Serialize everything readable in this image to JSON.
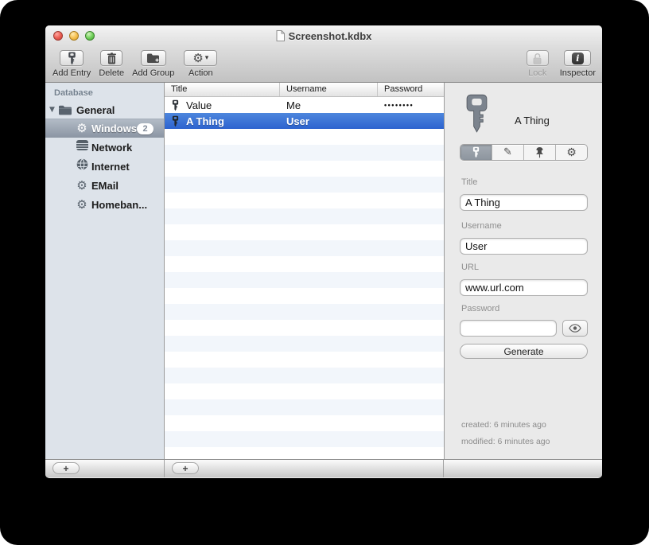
{
  "window": {
    "title": "Screenshot.kdbx"
  },
  "toolbar": {
    "add_entry_label": "Add Entry",
    "delete_label": "Delete",
    "add_group_label": "Add Group",
    "action_label": "Action",
    "lock_label": "Lock",
    "inspector_label": "Inspector"
  },
  "sidebar": {
    "header": "Database",
    "root": {
      "label": "General"
    },
    "items": [
      {
        "label": "Windows",
        "icon": "gear-icon",
        "badge": "2",
        "selected": true
      },
      {
        "label": "Network",
        "icon": "network-icon"
      },
      {
        "label": "Internet",
        "icon": "globe-icon"
      },
      {
        "label": "EMail",
        "icon": "gear-icon"
      },
      {
        "label": "Homeban...",
        "icon": "gear-icon"
      }
    ]
  },
  "table": {
    "columns": [
      "Title",
      "Username",
      "Password"
    ],
    "rows": [
      {
        "title": "Value",
        "username": "Me",
        "password": "••••••••",
        "selected": false
      },
      {
        "title": "A Thing",
        "username": "User",
        "password": "",
        "selected": true
      }
    ]
  },
  "inspector": {
    "entry_title": "A Thing",
    "tabs": [
      "key",
      "pencil",
      "pushpin",
      "gear"
    ],
    "fields": {
      "title": {
        "label": "Title",
        "value": "A Thing"
      },
      "username": {
        "label": "Username",
        "value": "User"
      },
      "url": {
        "label": "URL",
        "value": "www.url.com"
      },
      "password": {
        "label": "Password",
        "value": ""
      }
    },
    "generate_label": "Generate",
    "created": "created: 6 minutes ago",
    "modified": "modified: 6 minutes ago"
  },
  "bottombar": {
    "add_label": "+"
  },
  "icons": {
    "gear": "⚙",
    "pencil": "✎",
    "caret_down": "▾",
    "disclosure_down": "▼",
    "info": "i"
  },
  "colors": {
    "selection_blue": "#3a70d6",
    "sidebar_selection": "#98a2af",
    "sidebar_bg": "#dde3ea"
  }
}
